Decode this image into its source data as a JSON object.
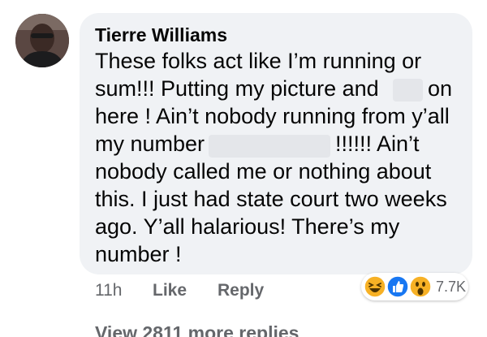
{
  "comment": {
    "author": "Tierre Williams",
    "lines": [
      "These folks act like I’m running or",
      "sum!!! Putting my picture and",
      "on",
      "here ! Ain’t nobody running from y’all",
      "my number",
      "!!!!!! Ain’t",
      "nobody called me or nothing about",
      "this. I just had state court two weeks",
      "ago. Y’all halarious! There’s my",
      "number !"
    ],
    "time": "11h",
    "like_label": "Like",
    "reply_label": "Reply",
    "reaction_count": "7.7K",
    "reaction_icons": [
      "haha-icon",
      "like-icon",
      "wow-icon"
    ]
  },
  "replies": {
    "view_more_label": "View 2811 more replies"
  },
  "colors": {
    "bubble": "#f0f2f5",
    "text": "#050505",
    "meta": "#65676b",
    "like_blue": "#1877f2",
    "emoji_yellow": "#f7b125"
  }
}
